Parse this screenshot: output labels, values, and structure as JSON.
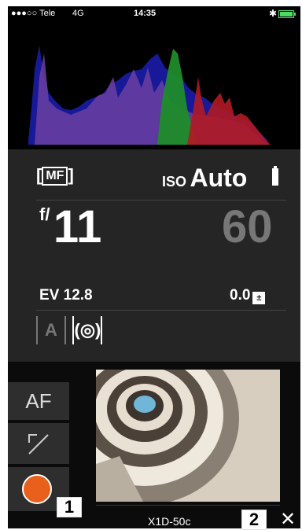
{
  "status": {
    "carrier": "●●●○○ Tele",
    "network": "4G",
    "time": "14:35",
    "bluetooth": "✱"
  },
  "exposure": {
    "focus_mode": "MF",
    "iso_label": "ISO",
    "iso_value": "Auto",
    "aperture_prefix": "f/",
    "aperture": "11",
    "shutter": "60",
    "ev": "EV 12.8",
    "ev_comp": "0.0",
    "ev_comp_icon": "±",
    "exposure_mode": "A",
    "metering": "(◎)"
  },
  "sidebar": {
    "af_label": "AF",
    "expand_icon": "↖↘"
  },
  "camera_name": "X1D-50c",
  "close_symbol": "✕",
  "badges": {
    "one": "1",
    "two": "2"
  },
  "colors": {
    "record": "#e8601b",
    "panel": "#252525",
    "battery": "#4cd964"
  }
}
